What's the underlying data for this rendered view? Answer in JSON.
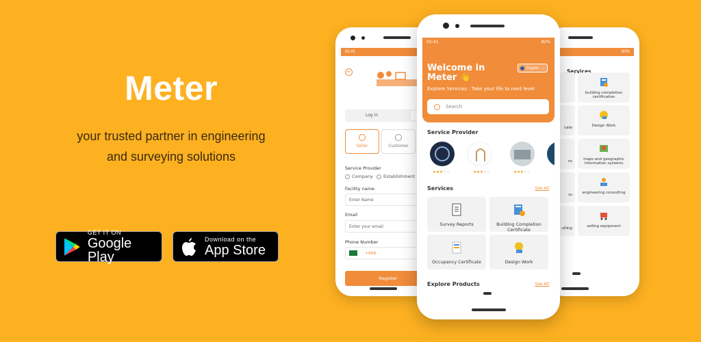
{
  "hero": {
    "title": "Meter",
    "subtitle_line1": "your trusted partner in engineering",
    "subtitle_line2": "and surveying solutions"
  },
  "stores": {
    "google_small": "GET IT ON",
    "google_big": "Google Play",
    "apple_small": "Download on the",
    "apple_big": "App Store"
  },
  "left_phone": {
    "status_time": "02:41",
    "tab_login": "Log In",
    "role_seller": "Seller",
    "role_customer": "Customer",
    "service_provider_label": "Service Provider",
    "radio_company": "Company",
    "radio_establishment": "Establishment",
    "facility_label": "Facility name",
    "facility_placeholder": "Enter Name",
    "email_label": "Email",
    "email_placeholder": "Enter your email",
    "phone_label": "Phone Number",
    "phone_prefix": "+966",
    "register": "Register"
  },
  "main_phone": {
    "status_time": "02:41",
    "status_battery": "82%",
    "welcome": "Welcome in Meter",
    "wave": "👋",
    "language": "English",
    "explore_services": "Explore Services",
    "explore_tagline": ": Take your life to next level",
    "search_placeholder": "Search",
    "service_provider_title": "Service Provider",
    "services_title": "Services",
    "see_all": "See All",
    "services": [
      {
        "label": "Survey Reports",
        "icon": "document-icon"
      },
      {
        "label": "Building Completion Certificate",
        "icon": "building-certificate-icon"
      },
      {
        "label": "Occupancy Certificate",
        "icon": "certificate-icon"
      },
      {
        "label": "Design Work",
        "icon": "design-icon"
      }
    ],
    "explore_products_title": "Explore Products",
    "provider_ratings": [
      3,
      3,
      3
    ]
  },
  "right_phone": {
    "status_battery": "80%",
    "title": "Services",
    "cards": [
      "building completion certification",
      "Design Work",
      "maps and geographic information systems",
      "engineering consulting",
      "selling equipment"
    ],
    "left_partial": [
      "cate",
      "ns",
      "ss",
      "ulting"
    ]
  },
  "colors": {
    "background": "#FDB121",
    "accent": "#F08C3A"
  }
}
